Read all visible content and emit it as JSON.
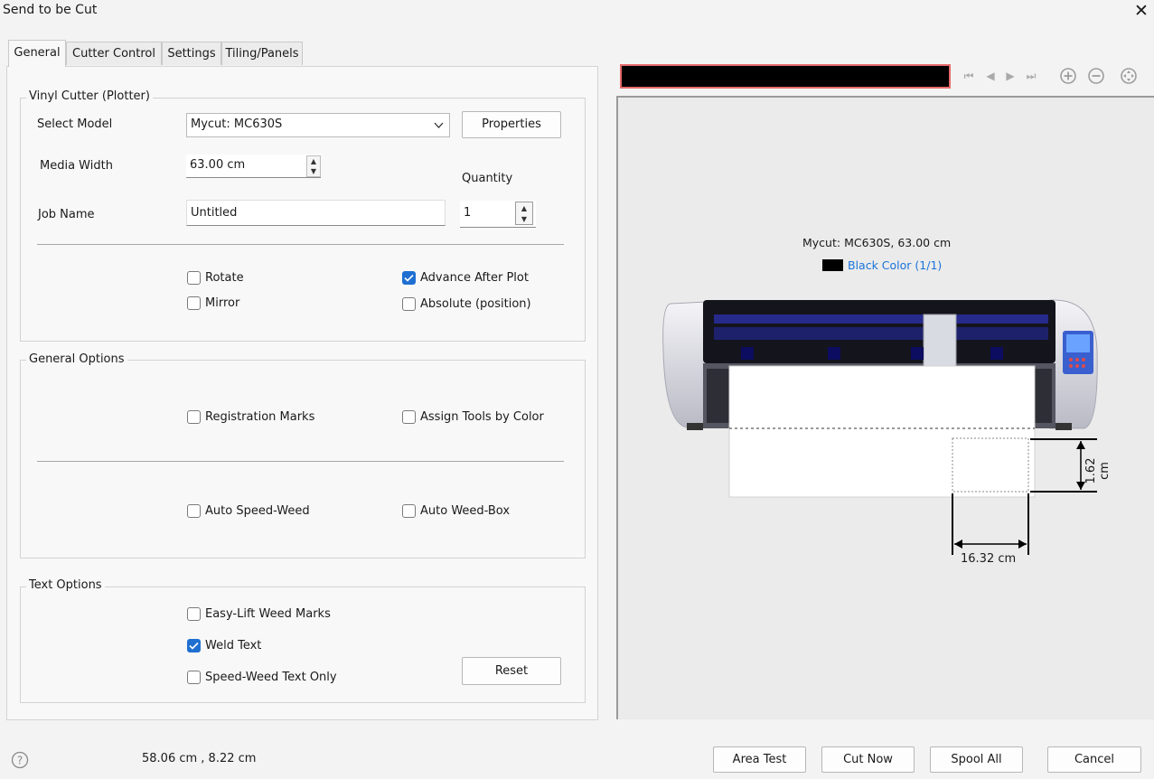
{
  "window": {
    "title": "Send to be Cut"
  },
  "tabs": [
    {
      "label": "General"
    },
    {
      "label": "Cutter Control"
    },
    {
      "label": "Settings"
    },
    {
      "label": "Tiling/Panels"
    }
  ],
  "vinyl_cutter": {
    "group_title": "Vinyl Cutter (Plotter)",
    "select_model_label": "Select Model",
    "model_value": "Mycut: MC630S",
    "properties_label": "Properties",
    "media_width_label": "Media Width",
    "media_width_value": "63.00 cm",
    "quantity_label": "Quantity",
    "quantity_value": "1",
    "job_name_label": "Job Name",
    "job_name_value": "Untitled",
    "rotate_label": "Rotate",
    "mirror_label": "Mirror",
    "advance_label": "Advance After Plot",
    "absolute_label": "Absolute (position)"
  },
  "general_options": {
    "group_title": "General Options",
    "registration_label": "Registration Marks",
    "assign_tools_label": "Assign Tools by Color",
    "auto_speed_weed_label": "Auto Speed-Weed",
    "auto_weed_box_label": "Auto Weed-Box"
  },
  "text_options": {
    "group_title": "Text Options",
    "easy_lift_label": "Easy-Lift Weed Marks",
    "weld_text_label": "Weld Text",
    "speed_weed_text_label": "Speed-Weed Text Only",
    "reset_label": "Reset"
  },
  "preview": {
    "device_caption": "Mycut: MC630S,  63.00 cm",
    "color_label": "Black Color (1/1)",
    "height_dim": "1.62 cm",
    "width_dim": "16.32 cm"
  },
  "status": {
    "coords": "58.06 cm , 8.22 cm"
  },
  "buttons": {
    "area_test": "Area Test",
    "cut_now": "Cut Now",
    "spool_all": "Spool All",
    "cancel": "Cancel"
  },
  "colors": {
    "accent": "#1f6fd1",
    "link": "#1a73d9"
  },
  "icons": [
    "close-icon",
    "dropdown-chevron-icon",
    "first-page-icon",
    "prev-page-icon",
    "next-page-icon",
    "last-page-icon",
    "zoom-in-icon",
    "zoom-out-icon",
    "fit-view-icon",
    "help-icon",
    "checkmark-icon"
  ]
}
